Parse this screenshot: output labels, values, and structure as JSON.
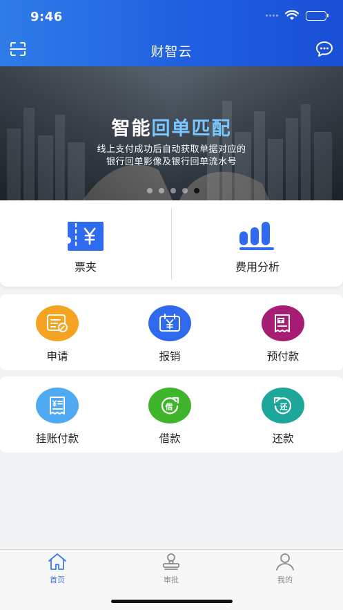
{
  "status": {
    "time": "9:46"
  },
  "header": {
    "title": "财智云",
    "scan_icon": "scan-icon",
    "chat_icon": "chat-bubble-icon"
  },
  "banner": {
    "title_plain": "智能",
    "title_highlight": "回单匹配",
    "subtitle_line1": "线上支付成功后自动获取单据对应的",
    "subtitle_line2": "银行回单影像及银行回单流水号",
    "dot_count": 5,
    "active_dot": 4
  },
  "quick": [
    {
      "label": "票夹",
      "icon": "ticket-yen-icon"
    },
    {
      "label": "费用分析",
      "icon": "bar-chart-icon"
    }
  ],
  "grid1": [
    {
      "label": "申请",
      "icon": "apply-form-icon",
      "color": "#f5a320"
    },
    {
      "label": "报销",
      "icon": "reimburse-calendar-icon",
      "color": "#2e69ee"
    },
    {
      "label": "预付款",
      "icon": "prepay-receipt-icon",
      "color": "#a61d73"
    }
  ],
  "grid2": [
    {
      "label": "挂账付款",
      "icon": "credit-payment-icon",
      "color": "#4fa9f3"
    },
    {
      "label": "借款",
      "icon": "borrow-icon",
      "color": "#3fb52c"
    },
    {
      "label": "还款",
      "icon": "repay-icon",
      "color": "#1da69a"
    }
  ],
  "tabs": [
    {
      "label": "首页",
      "icon": "home-icon"
    },
    {
      "label": "审批",
      "icon": "approval-stamp-icon"
    },
    {
      "label": "我的",
      "icon": "profile-icon"
    }
  ],
  "colors": {
    "brand": "#1f5fe0",
    "tab_active": "#3a78f2"
  }
}
